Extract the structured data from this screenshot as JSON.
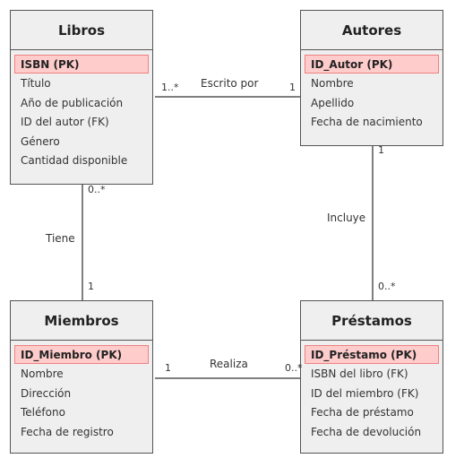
{
  "entities": {
    "libros": {
      "title": "Libros",
      "pk": "ISBN (PK)",
      "attributes": [
        "Título",
        "Año de publicación",
        "ID del autor (FK)",
        "Género",
        "Cantidad disponible"
      ]
    },
    "autores": {
      "title": "Autores",
      "pk": "ID_Autor (PK)",
      "attributes": [
        "Nombre",
        "Apellido",
        "Fecha de nacimiento"
      ]
    },
    "miembros": {
      "title": "Miembros",
      "pk": "ID_Miembro (PK)",
      "attributes": [
        "Nombre",
        "Dirección",
        "Teléfono",
        "Fecha de registro"
      ]
    },
    "prestamos": {
      "title": "Préstamos",
      "pk": "ID_Préstamo (PK)",
      "attributes": [
        "ISBN del libro (FK)",
        "ID del miembro (FK)",
        "Fecha de préstamo",
        "Fecha de devolución"
      ]
    }
  },
  "relationships": {
    "escrito_por": {
      "label": "Escrito por",
      "from_mult": "1..*",
      "to_mult": "1"
    },
    "tiene": {
      "label": "Tiene",
      "from_mult": "0..*",
      "to_mult": "1"
    },
    "incluye": {
      "label": "Incluye",
      "from_mult": "1",
      "to_mult": "0..*"
    },
    "realiza": {
      "label": "Realiza",
      "from_mult": "1",
      "to_mult": "0..*"
    }
  },
  "colors": {
    "pk_fill": "#ffcccc",
    "pk_border": "#f08080",
    "entity_fill": "#efefef",
    "line": "#555555"
  }
}
